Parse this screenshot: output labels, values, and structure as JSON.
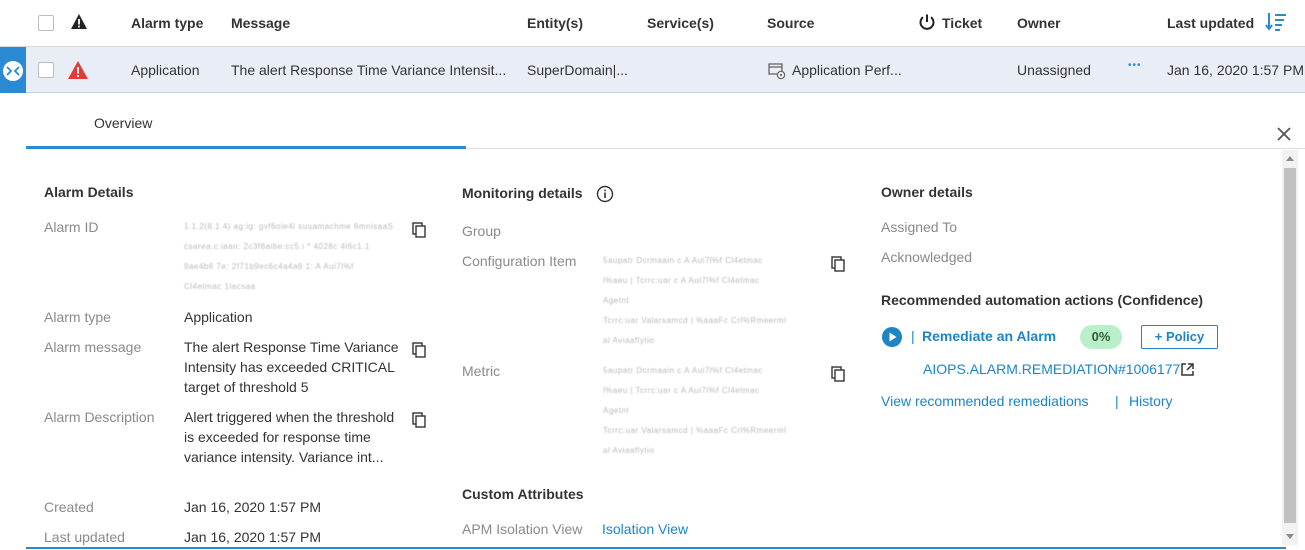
{
  "header": {
    "col_alarm_type": "Alarm type",
    "col_message": "Message",
    "col_entities": "Entity(s)",
    "col_services": "Service(s)",
    "col_source": "Source",
    "col_ticket": "Ticket",
    "col_owner": "Owner",
    "col_last_updated": "Last updated"
  },
  "alarm_row": {
    "alarm_type": "Application",
    "message": "The alert Response Time Variance Intensit...",
    "entity": "SuperDomain|...",
    "source": "Application Perf...",
    "owner": "Unassigned",
    "more": "•••",
    "last_updated": "Jan 16, 2020 1:57 PM"
  },
  "tabs": {
    "overview": "Overview"
  },
  "alarm_details": {
    "title": "Alarm Details",
    "alarm_id_label": "Alarm ID",
    "alarm_id_lines": [
      "1.1.2(8.1.4) ag:ig:  gvf6ole4l  suuamachme  6mnisaaS",
      "csarea:c:iaan:  2c3f6aibe:cc5.i  * 4028c  4l6c1.1",
      "9ae4b6  7e:  2f71b9ec6c4a4a6  1:  A  Aui7l%f",
      "Cl4etmac  1lacsaa"
    ],
    "alarm_type_label": "Alarm type",
    "alarm_type_value": "Application",
    "alarm_message_label": "Alarm message",
    "alarm_message_value": "The alert Response Time Variance Intensity has exceeded CRITICAL target of threshold 5",
    "alarm_description_label": "Alarm Description",
    "alarm_description_value": "Alert triggered when the threshold is exceeded for response time variance intensity. Variance int...",
    "created_label": "Created",
    "created_value": "Jan 16, 2020 1:57 PM",
    "last_updated_label": "Last updated",
    "last_updated_value": "Jan 16, 2020 1:57 PM"
  },
  "monitoring_details": {
    "title": "Monitoring details",
    "group_label": "Group",
    "config_item_label": "Configuration Item",
    "config_item_lines": [
      "5aupatr  Dcrmaain  c  A  Aui7l%f  Cl4etmac",
      "l%aeu  |  Tcrrc:uar  c  A  Aui7l%f  Cl4etmac",
      "Agetnt",
      "Tcrrc:uar  Valarsamcd  |  %aaaFc  Crl%Rmeerml",
      "al  Aviaaflytio"
    ],
    "metric_label": "Metric",
    "metric_lines": [
      "5aupatr  Dcrmaain  c  A  Aui7l%f  Cl4etmac",
      "l%aeu  |  Tcrrc:uar  c  A  Aui7l%f  Cl4etmac",
      "Agetnt",
      "Tcrrc:uar  Valarsamcd  |  %aaaFc  Crl%Rmeerml",
      "al  Aviaaflytio"
    ],
    "custom_attributes_title": "Custom Attributes",
    "apm_isolation_label": "APM Isolation View",
    "apm_isolation_link": "Isolation View"
  },
  "owner_details": {
    "title": "Owner details",
    "assigned_to_label": "Assigned To",
    "acknowledged_label": "Acknowledged",
    "recommended_title": "Recommended automation actions (Confidence)",
    "action_name": "Remediate an Alarm",
    "confidence": "0%",
    "policy_button": "+ Policy",
    "action_link": "AIOPS.ALARM.REMEDIATION#1006177",
    "view_remediations_link": "View recommended remediations",
    "separator": "|",
    "history_link": "History"
  },
  "colors": {
    "accent": "#2a8ad4",
    "link": "#1d84c6",
    "critical": "#e53935",
    "confidence_badge": "#b9efc9"
  }
}
